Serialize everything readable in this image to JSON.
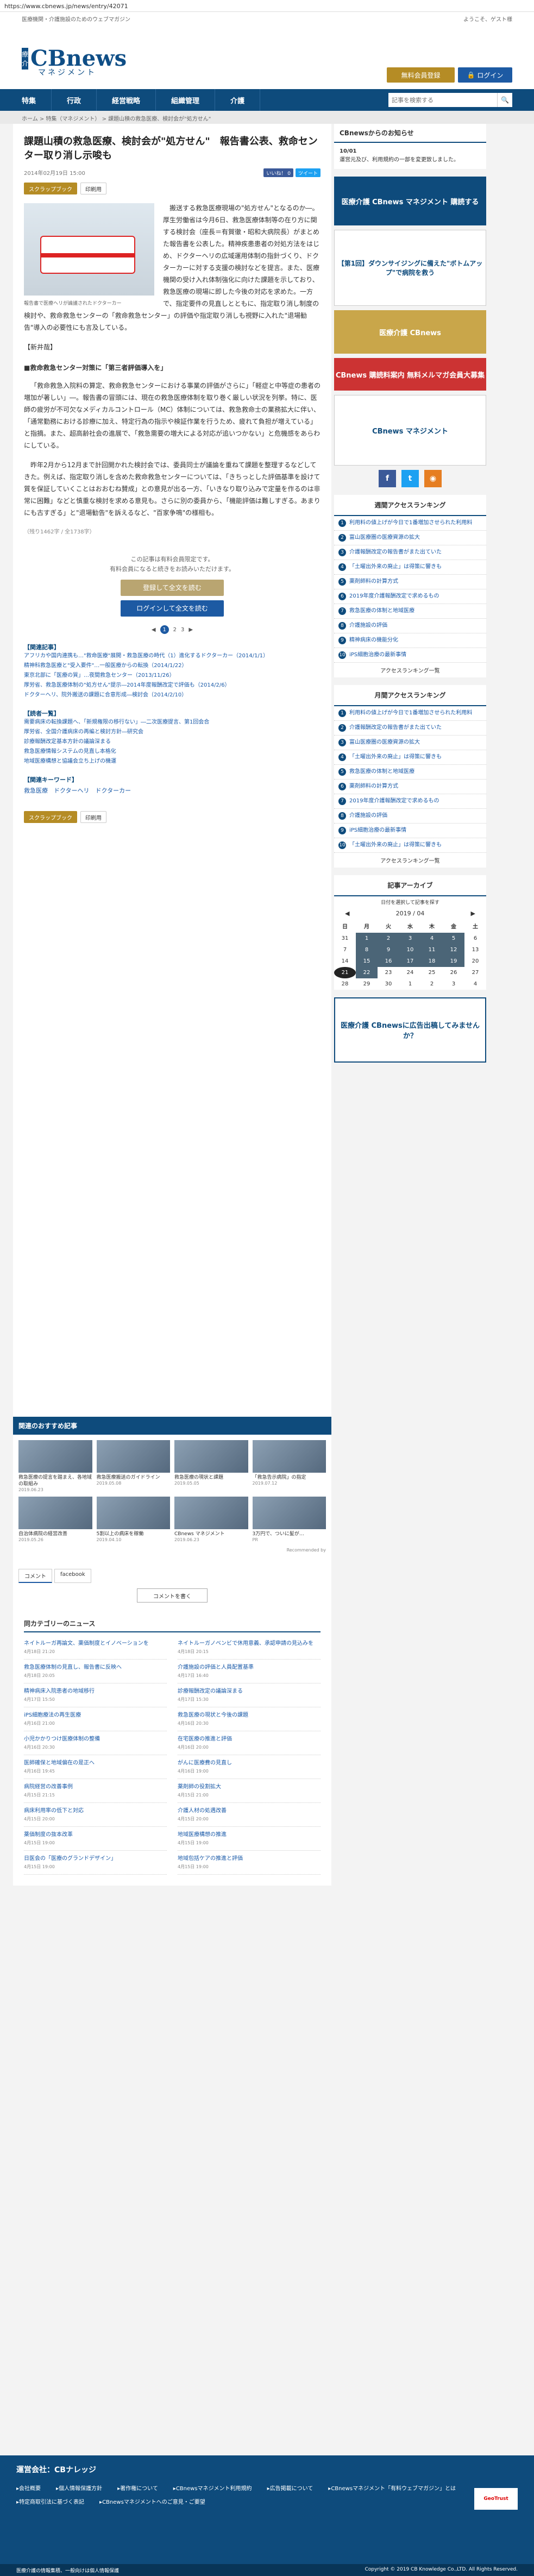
{
  "browser": {
    "url": "https://www.cbnews.jp/news/entry/42071"
  },
  "topstrip": {
    "left": "医療機関・介護施設のためのウェブマガジン",
    "right": "ようこそ、ゲスト様"
  },
  "header": {
    "logo_c": "医療介護",
    "logo_main": "CBnews",
    "logo_sub": "マネジメント",
    "btn_free": "無料会員登録",
    "btn_login": "ログイン"
  },
  "nav": {
    "items": [
      "特集",
      "行政",
      "経営戦略",
      "組織管理",
      "介護"
    ],
    "search_placeholder": "記事を検索する"
  },
  "breadcrumb": "ホーム > 特集（マネジメント） > 課題山積の救急医療、検討会が\"処方せん\"",
  "article": {
    "title": "課題山積の救急医療、検討会が\"処方せん\"　報告書公表、救命センター取り消し示唆も",
    "date": "2014年02月19日 15:00",
    "like": "いいね！ 0",
    "tweet": "ツイート",
    "tag_scrap": "スクラップブック",
    "tag_print": "印刷用",
    "photo_caption": "報告書で医療ヘリが論議されたドクターカー",
    "p1": "搬送する救急医療現場の\"処方せん\"となるのか―。厚生労働省は今月6日、救急医療体制等の在り方に関する検討会（座長＝有賀徹・昭和大病院長）がまとめた報告書を公表した。精神疾患患者の対処方法をはじめ、ドクターヘリの広域運用体制の指針づくり、ドクターカーに対する支援の検討などを提言。また、医療機関の受け入れ体制強化に向けた課題を示しており、救急医療の現場に即した今後の対応を求めた。一方で、指定要件の見直しとともに、指定取り消し制度の検討や、救命救急センターの「救命救急センター」の評価や指定取り消しも視野に入れた\"退場勧告\"導入の必要性にも言及している。",
    "p1_tail": "【新井哉】",
    "h1": "■救命救急センター対策に「第三者評価導入を」",
    "p2": "「救命救急入院料の算定、救命救急センターにおける事業の評価がさらに」「軽症と中等症の患者の増加が著しい」―。報告書の冒頭には、現在の救急医療体制を取り巻く厳しい状況を列挙。特に、医師の疲労が不可欠なメディカルコントロール（MC）体制については、救急救命士の業務拡大に伴い、「通常勤務における診療に加え、特定行為の指示や検証作業を行うため、疲れて負担が増えている」と指摘。また、超高齢社会の進展で、「救急需要の増大による対応が追いつかない」と危機感をあらわにしている。",
    "p3": "昨年2月から12月まで計回開かれた検討会では、委員同士が議論を重ねて課題を整理するなどしてきた。例えば、指定取り消しを含めた救命救急センターについては、「きちっとした評価基準を設けて質を保証していくことはおおむね賛成」との意見が出る一方、「いきなり取り込みで定量を作るのは非常に困難」などと慎重な検討を求める意見も。さらに別の委員から、「機能評価は難しすぎる。あまりにも古すぎる」と\"退場勧告\"を訴えるなど、\"百家争鳴\"の様相も。",
    "p3_tail": "（残り1462字 / 全1738字）",
    "paywall1": "この記事は有料会員限定です。",
    "paywall2": "有料会員になると続きをお読みいただけます。",
    "pw_btn1": "登録して全文を読む",
    "pw_btn2": "ログインして全文を読む",
    "pager": [
      "1",
      "2",
      "3"
    ],
    "related_title": "【関連記事】",
    "related": [
      "アフリカや国内連携も…\"救命医療\"展開・救急医療の時代（1）進化するドクターカー（2014/1/1）",
      "精神科救急医療と\"受入要件\"…一般医療からの転換（2014/1/22）",
      "東京北部に「医療の質」…夜間救急センター（2013/11/26）",
      "厚労省、救急医療体制の\"処方せん\"提示―2014年度報酬改定で評価も（2014/2/6）",
      "ドクターヘリ、院外搬送の課題に合意形成―検討会（2014/2/10）"
    ],
    "reading_title": "【読者一覧】",
    "reading": [
      "需要病床の転換課題へ、「新規権限の移行ない」―二次医療提言、第1回会合",
      "厚労省、全国介護病床の再編と検討方針―研究会",
      "診療報酬改定基本方針の議論深まる",
      "救急医療情報システムの見直し本格化",
      "地域医療構想と協議会立ち上げの機運"
    ],
    "kw_title": "【関連キーワード】",
    "keywords": "救急医療　ドクターヘリ　ドクターカー",
    "bottom_tag_scrap": "スクラップブック",
    "bottom_tag_print": "印刷用"
  },
  "sidebar": {
    "notice_title": "CBnewsからのお知らせ",
    "notice_date": "10/01",
    "notice_text": "運営元及び、利用規約の一部を変更致しました。",
    "ad1": "医療介護 CBnews マネジメント 購読する",
    "ad2": "【第1回】ダウンサイジングに備えた\"ボトムアップ\"で病院を救う",
    "ad3": "医療介護 CBnews",
    "ad4": "CBnews 購読料案内 無料メルマガ会員大募集",
    "ad5": "CBnews マネジメント",
    "access_title": "週間アクセスランキング",
    "weekly": [
      "利用料の値上げが今日で1番増加させられた利用料",
      "富山医療圏の医療資源の拡大",
      "介護報酬改定の報告書がまた出ていた",
      "「土曜出外来の廃止」は得策に響きも",
      "薬剤師料の計算方式",
      "2019年度介護報酬改定で求めるもの",
      "救急医療の体制と地域医療",
      "介護施設の評価",
      "精神病床の機能分化",
      "iPS細胞治療の最新事情"
    ],
    "weekly_more": "アクセスランキング一覧",
    "monthly_title": "月間アクセスランキング",
    "monthly": [
      "利用料の値上げが今日で1番増加させられた利用料",
      "介護報酬改定の報告書がまた出ていた",
      "富山医療圏の医療資源の拡大",
      "「土曜出外来の廃止」は得策に響きも",
      "救急医療の体制と地域医療",
      "薬剤師料の計算方式",
      "2019年度介護報酬改定で求めるもの",
      "介護施設の評価",
      "iPS細胞治療の最新事情",
      "「土曜出外来の廃止」は得策に響きも"
    ],
    "monthly_more": "アクセスランキング一覧",
    "calendar_title": "記事アーカイブ",
    "calendar_sub": "日付を選択して記事を探す",
    "calendar_month": "2019 / 04",
    "calendar_days": [
      "日",
      "月",
      "火",
      "水",
      "木",
      "金",
      "土"
    ],
    "calendar_rows": [
      [
        "31",
        "1",
        "2",
        "3",
        "4",
        "5",
        "6"
      ],
      [
        "7",
        "8",
        "9",
        "10",
        "11",
        "12",
        "13"
      ],
      [
        "14",
        "15",
        "16",
        "17",
        "18",
        "19",
        "20"
      ],
      [
        "21",
        "22",
        "23",
        "24",
        "25",
        "26",
        "27"
      ],
      [
        "28",
        "29",
        "30",
        "1",
        "2",
        "3",
        "4"
      ]
    ],
    "ad_bottom": "医療介護 CBnewsに広告出稿してみませんか？"
  },
  "recommend": {
    "title": "関連のおすすめ記事",
    "cards": [
      {
        "t": "救急医療の提言を踏まえ、各地域の取組み",
        "d": "2019.06.23"
      },
      {
        "t": "救急医療搬送のガイドライン",
        "d": "2019.05.08"
      },
      {
        "t": "救急医療の現状と課題",
        "d": "2019.05.05"
      },
      {
        "t": "「救急告示病院」の指定",
        "d": "2019.07.12"
      },
      {
        "t": "自治体病院の経営改善",
        "d": "2019.05.26"
      },
      {
        "t": "5割以上の病床を稼働",
        "d": "2019.04.10"
      },
      {
        "t": "CBnews マネジメント",
        "d": "2019.06.23"
      },
      {
        "t": "3万円で、ついに髪が…",
        "d": "PR"
      }
    ],
    "powered": "Recommended by"
  },
  "comment": {
    "tab1": "コメント",
    "tab2": "facebook",
    "btn": "コメントを書く"
  },
  "samecat": {
    "title": "同カテゴリーのニュース",
    "items": [
      {
        "t": "ネイトルーガ再論文、薬価制度とイノベーションを",
        "d": "4月18日 21:20"
      },
      {
        "t": "ネイトルーガノベンビで休用意義、承認申請の見込みを",
        "d": "4月18日 20:15"
      },
      {
        "t": "救急医療体制の見直し、報告書に反映へ",
        "d": "4月18日 20:05"
      },
      {
        "t": "介護施設の評価と人員配置基準",
        "d": "4月17日 16:40"
      },
      {
        "t": "精神病床入院患者の地域移行",
        "d": "4月17日 15:50"
      },
      {
        "t": "診療報酬改定の議論深まる",
        "d": "4月17日 15:30"
      },
      {
        "t": "iPS細胞療法の再生医療",
        "d": "4月16日 21:00"
      },
      {
        "t": "救急医療の現状と今後の課題",
        "d": "4月16日 20:30"
      },
      {
        "t": "小児かかりつけ医療体制の整備",
        "d": "4月16日 20:30"
      },
      {
        "t": "在宅医療の推進と評価",
        "d": "4月16日 20:00"
      },
      {
        "t": "医師確保と地域偏在の是正へ",
        "d": "4月16日 19:45"
      },
      {
        "t": "がんに医療費の見直し",
        "d": "4月16日 19:00"
      },
      {
        "t": "病院経営の改善事例",
        "d": "4月15日 21:15"
      },
      {
        "t": "薬剤師の役割拡大",
        "d": "4月15日 21:00"
      },
      {
        "t": "病床利用率の低下と対応",
        "d": "4月15日 20:00"
      },
      {
        "t": "介護人材の処遇改善",
        "d": "4月15日 20:00"
      },
      {
        "t": "薬価制度の抜本改革",
        "d": "4月15日 19:00"
      },
      {
        "t": "地域医療構想の推進",
        "d": "4月15日 19:00"
      },
      {
        "t": "日医会の「医療のグランドデザイン」",
        "d": "4月15日 19:00"
      },
      {
        "t": "地域包括ケアの推進と評価",
        "d": "4月15日 19:00"
      }
    ]
  },
  "footer": {
    "title": "運営会社：CBナレッジ",
    "links": [
      "会社概要",
      "個人情報保護方針",
      "著作権について",
      "CBnewsマネジメント利用規約",
      "広告掲載について",
      "CBnewsマネジメント「有料ウェブマガジン」とは",
      "特定商取引法に基づく表記",
      "CBnewsマネジメントへのご意見・ご要望"
    ],
    "badge": "GeoTrust",
    "copy_left": "医療介護の情報集積、一般向けは個人情報保護",
    "copy_right": "Copyright © 2019 CB Knowledge Co.,LTD. All Rights Reserved."
  }
}
